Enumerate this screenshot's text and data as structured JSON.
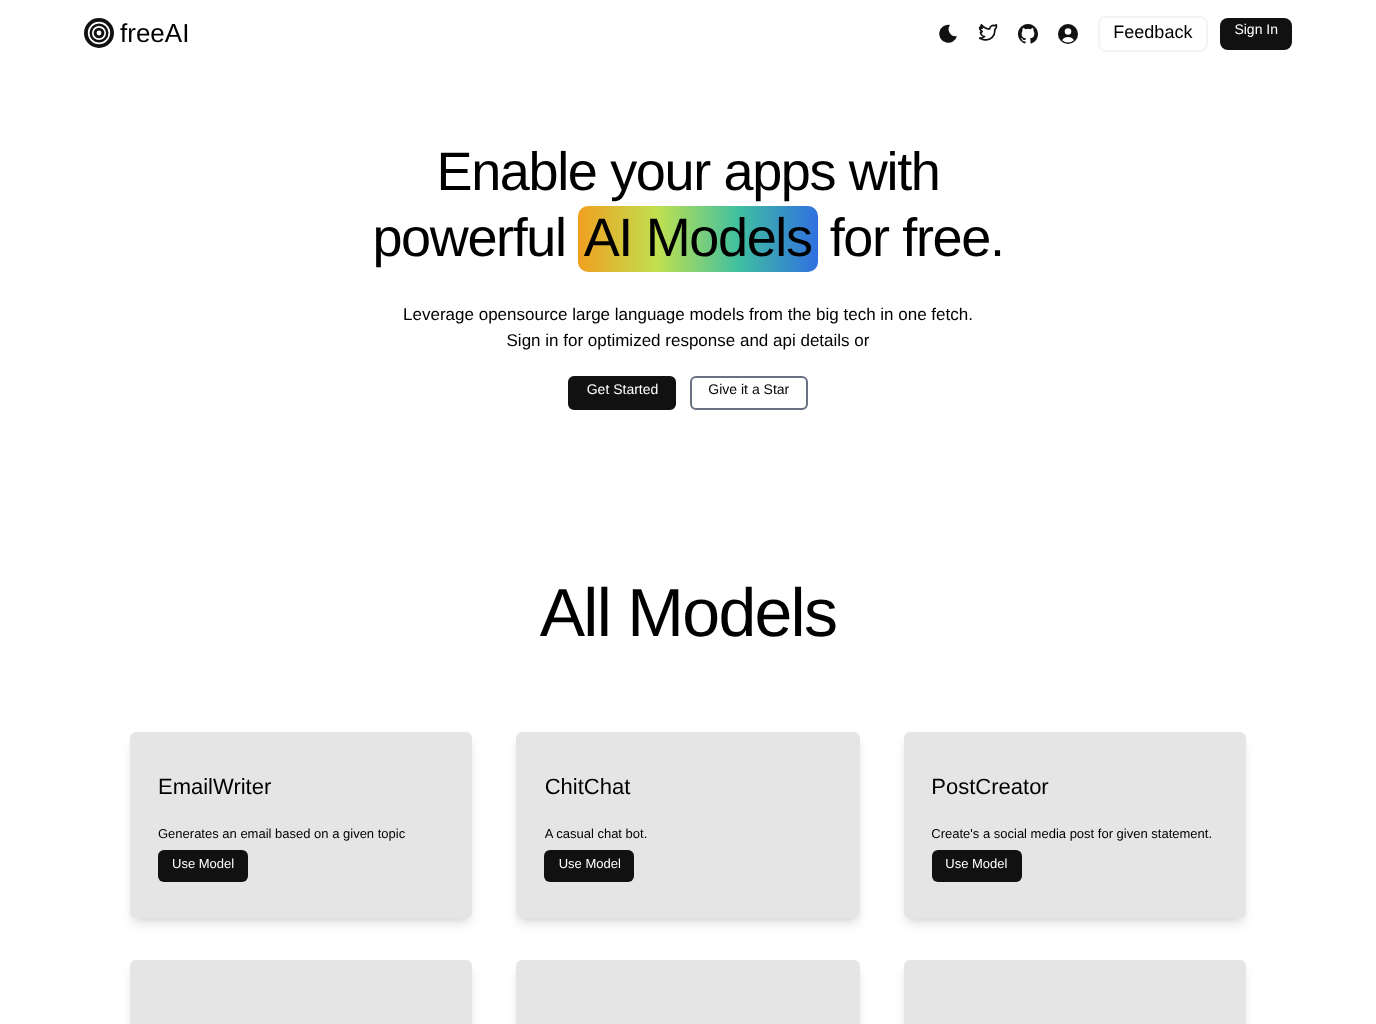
{
  "brand": {
    "name": "freeAI"
  },
  "nav": {
    "feedback": "Feedback",
    "sign_in": "Sign In"
  },
  "hero": {
    "line1": "Enable your apps with",
    "before": "powerful",
    "highlight": "AI Models",
    "after": "for free.",
    "description": "Leverage opensource large language models from the big tech in one fetch. Sign in for optimized response and api details or",
    "buttons": [
      {
        "label": "Get Started",
        "kind": "primary"
      },
      {
        "label": "Give it a Star",
        "kind": "outline"
      }
    ]
  },
  "models": {
    "title": "All Models",
    "cards": [
      {
        "name": "EmailWriter",
        "description": "Generates an email based on a given topic",
        "button": "Use Model"
      },
      {
        "name": "ChitChat",
        "description": "A casual chat bot.",
        "button": "Use Model"
      },
      {
        "name": "PostCreator",
        "description": "Create's a social media post for given statement.",
        "button": "Use Model"
      }
    ]
  }
}
